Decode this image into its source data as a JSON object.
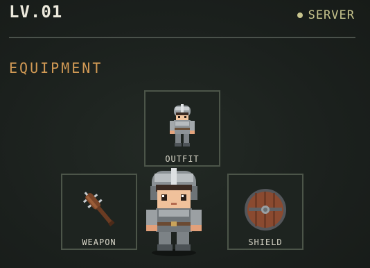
{
  "hud": {
    "level": "LV.01",
    "server_label": "SERVER"
  },
  "equipment": {
    "title": "EQUIPMENT",
    "slots": [
      {
        "label": "OUTFIT",
        "icon": "armor-outfit-icon"
      },
      {
        "label": "WEAPON",
        "icon": "spiked-club-icon"
      },
      {
        "label": "SHIELD",
        "icon": "round-wooden-shield-icon"
      }
    ]
  },
  "colors": {
    "background": "#1b201d",
    "accent": "#d29a55",
    "server": "#c8c58e",
    "slot_border": "#4c5549"
  }
}
